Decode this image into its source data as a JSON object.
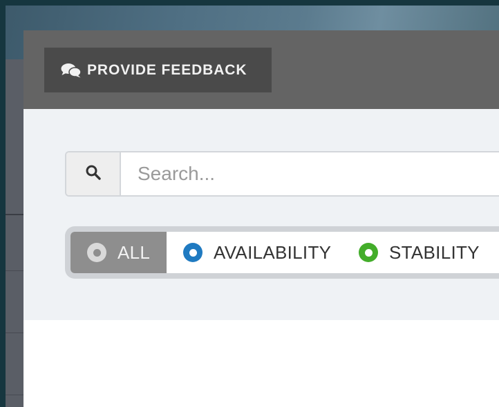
{
  "feedback": {
    "label": "PROVIDE FEEDBACK",
    "icon": "comments-icon"
  },
  "search": {
    "placeholder": "Search...",
    "value": "",
    "icon": "search-icon"
  },
  "filters": {
    "selected": "ALL",
    "items": [
      {
        "label": "ALL",
        "color": "#d9d9d9",
        "dot": "#8e8e8e"
      },
      {
        "label": "AVAILABILITY",
        "color": "#1f7ac1",
        "dot": "#ffffff"
      },
      {
        "label": "STABILITY",
        "color": "#43ad2a",
        "dot": "#ffffff"
      }
    ]
  },
  "colors": {
    "header_bg": "#646464",
    "button_bg": "#4a4a4a",
    "filter_area_bg": "#eff2f5",
    "selected_segment_bg": "#8e8e8e"
  }
}
